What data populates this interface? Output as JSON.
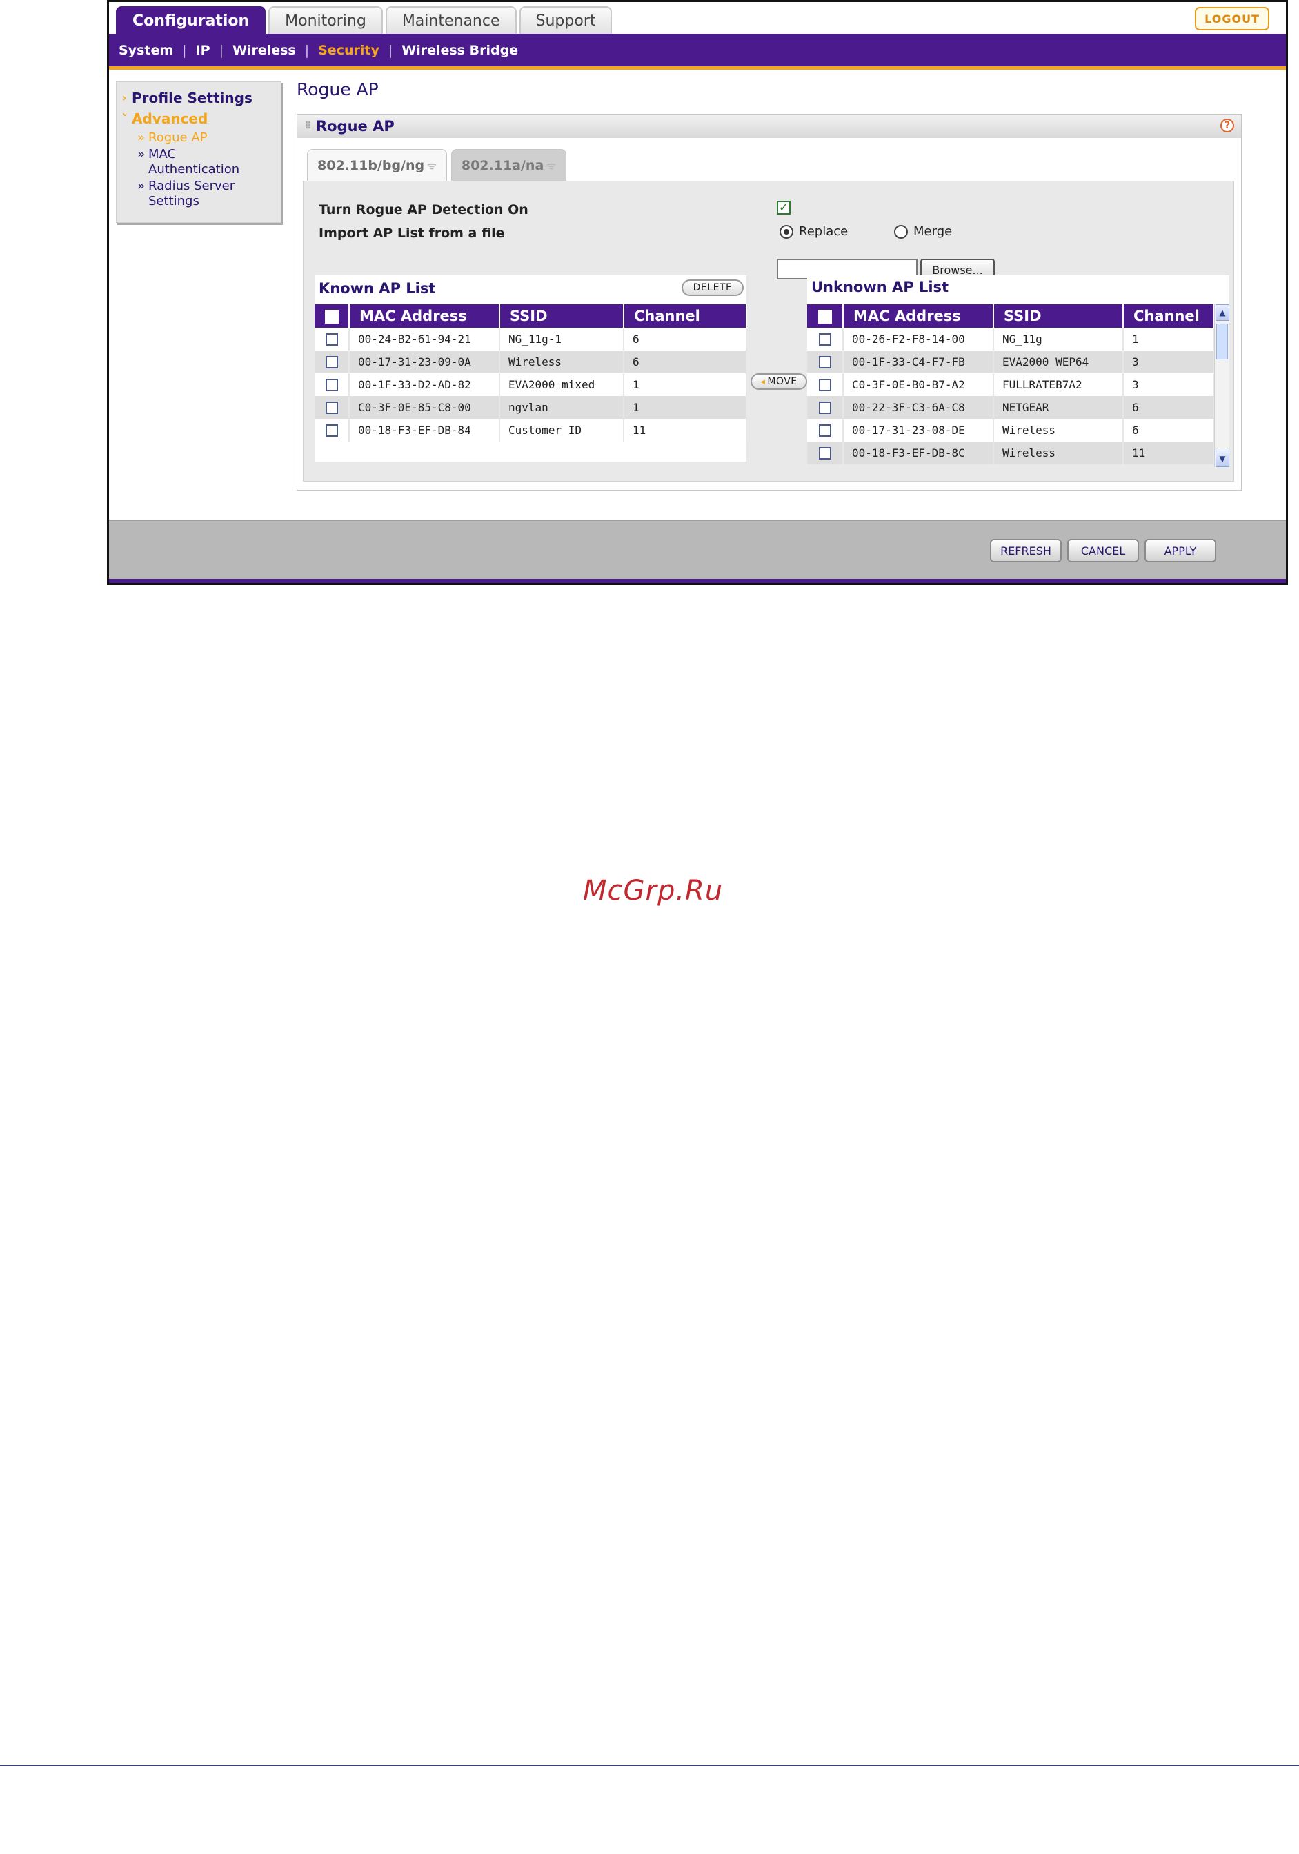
{
  "top_tabs": [
    "Configuration",
    "Monitoring",
    "Maintenance",
    "Support"
  ],
  "active_top_tab": "Configuration",
  "logout_label": "LOGOUT",
  "subnav": [
    "System",
    "IP",
    "Wireless",
    "Security",
    "Wireless Bridge"
  ],
  "active_subnav": "Security",
  "left_menu": {
    "profile_settings": "Profile Settings",
    "advanced": "Advanced",
    "rogue_ap": "Rogue AP",
    "mac_auth": "MAC Authentication",
    "radius": "Radius Server Settings"
  },
  "page_title": "Rogue AP",
  "panel_title": "Rogue AP",
  "band_tabs": [
    "802.11b/bg/ng",
    "802.11a/na"
  ],
  "form": {
    "detection_label": "Turn Rogue AP Detection On",
    "detection_on": true,
    "import_label": "Import AP List from a file",
    "replace_label": "Replace",
    "merge_label": "Merge",
    "selected_import_mode": "Replace",
    "browse_label": "Browse...",
    "file_value": ""
  },
  "known": {
    "title": "Known AP List",
    "delete_label": "DELETE",
    "columns": [
      "MAC Address",
      "SSID",
      "Channel"
    ],
    "rows": [
      [
        "00-24-B2-61-94-21",
        "NG_11g-1",
        "6"
      ],
      [
        "00-17-31-23-09-0A",
        "Wireless",
        "6"
      ],
      [
        "00-1F-33-D2-AD-82",
        "EVA2000_mixed",
        "1"
      ],
      [
        "C0-3F-0E-85-C8-00",
        "ngvlan",
        "1"
      ],
      [
        "00-18-F3-EF-DB-84",
        "Customer ID",
        "11"
      ]
    ]
  },
  "move_label": "MOVE",
  "unknown": {
    "title": "Unknown AP List",
    "columns": [
      "MAC Address",
      "SSID",
      "Channel"
    ],
    "rows": [
      [
        "00-26-F2-F8-14-00",
        "NG_11g",
        "1"
      ],
      [
        "00-1F-33-C4-F7-FB",
        "EVA2000_WEP64",
        "3"
      ],
      [
        "C0-3F-0E-B0-B7-A2",
        "FULLRATEB7A2",
        "3"
      ],
      [
        "00-22-3F-C3-6A-C8",
        "NETGEAR",
        "6"
      ],
      [
        "00-17-31-23-08-DE",
        "Wireless",
        "6"
      ],
      [
        "00-18-F3-EF-DB-8C",
        "Wireless",
        "11"
      ]
    ]
  },
  "buttons": {
    "refresh": "REFRESH",
    "cancel": "CANCEL",
    "apply": "APPLY"
  },
  "watermark": "McGrp.Ru",
  "colors": {
    "brand_purple": "#4b1a8c",
    "accent_orange": "#f3a61c"
  }
}
